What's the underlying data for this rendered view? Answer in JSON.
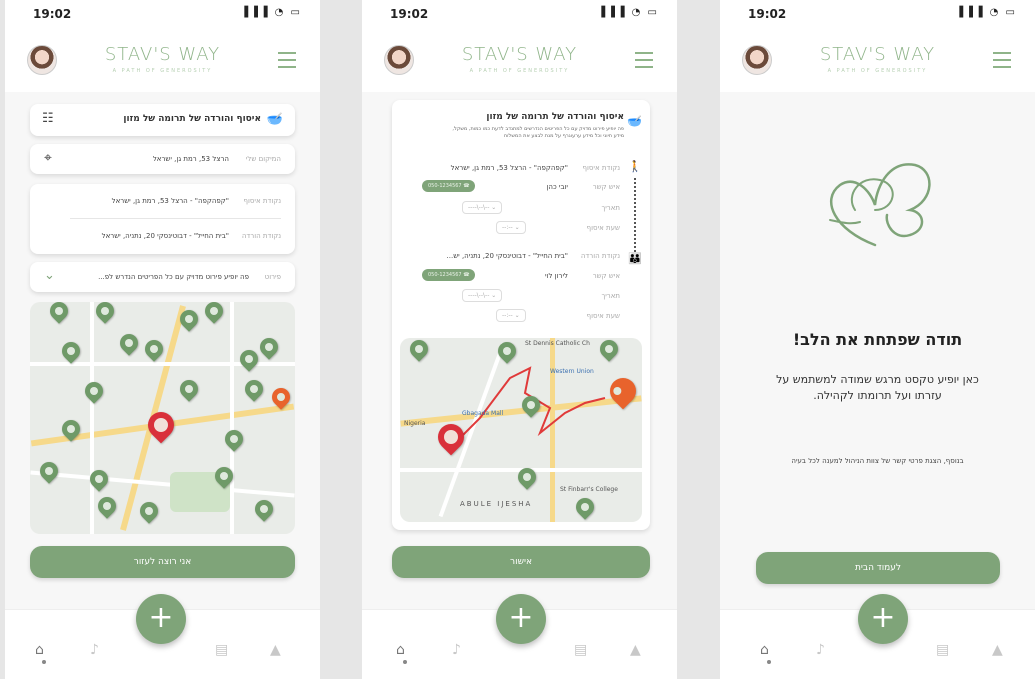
{
  "status": {
    "time": "19:02",
    "icons": "▐▐▐ ◔ ▭"
  },
  "brand": {
    "name": "STAV'S WAY",
    "tagline": "A PATH OF GENEROSITY"
  },
  "screen1": {
    "title": "איסוף והורדה של תרומה של מזון",
    "location_label": "המיקום שלי",
    "location_value": "הרצל 53, רמת גן, ישראל",
    "pickup_label": "נקודת איסוף",
    "pickup_value": "\"קפהקפה\" - הרצל 53, רמת גן, ישראל",
    "dropoff_label": "נקודת הורדה",
    "dropoff_value": "\"בית החייל\" - דבוטינסקי 20, נתניה, ישראל",
    "details_label": "פירוט",
    "details_value": "פה יופיע פירוט מדויק עם כל הפריטים הנדרש לפ...",
    "cta": "אני רוצה לעזור"
  },
  "screen2": {
    "title": "איסוף והורדה של תרומה של מזון",
    "desc": "פה יופיע פירוט מדויק עם כל הפריטים הנדרשים למתנדב לדעת כמו כמות, משקל, מידע חיוני וכל מידע ערעוגרף על מנת לבצע את המשלוח",
    "pickup_label": "נקודת איסוף",
    "pickup_value": "\"קפהקפה\" - הרצל 53, רמת גן, ישראל",
    "contact_label": "איש קשר",
    "contact1_name": "יובי כהן",
    "contact1_phone": "050-1234567",
    "date_label": "תאריך",
    "date_value": "--\\--\\----",
    "time_label": "שעת איסוף",
    "time_value": "--:--",
    "dropoff_label": "נקודת הורדה",
    "dropoff_value": "\"בית החייל\" - דבוטינסקי 20, נתניה, יש...",
    "contact2_name": "לירון לוי",
    "contact2_phone": "050-1234567",
    "map_labels": [
      "St Dennis Catholic Ch",
      "Western Union",
      "Nigeria",
      "Gbagada Mall",
      "St Finbarr's College",
      "ABULE IJESHA"
    ],
    "cta": "אישור"
  },
  "screen3": {
    "heading": "תודה שפתחת את הלב!",
    "body": "כאן יופיע טקסט מרגש שמודה למשתמש על עזרתו ועל תרומתו לקהילה.",
    "footer": "בנוסף, הצגת פרטי קשר של צוות הניהול למענה לכל בעיה",
    "cta": "לעמוד הבית"
  },
  "tabs": {
    "home_icon": "home-icon",
    "bell_icon": "bell-icon",
    "clipboard_icon": "clipboard-icon",
    "user_icon": "user-icon",
    "fab": "+"
  },
  "colors": {
    "primary": "#7fa479",
    "accent": "#e8632c",
    "pin_red": "#d9303a"
  }
}
